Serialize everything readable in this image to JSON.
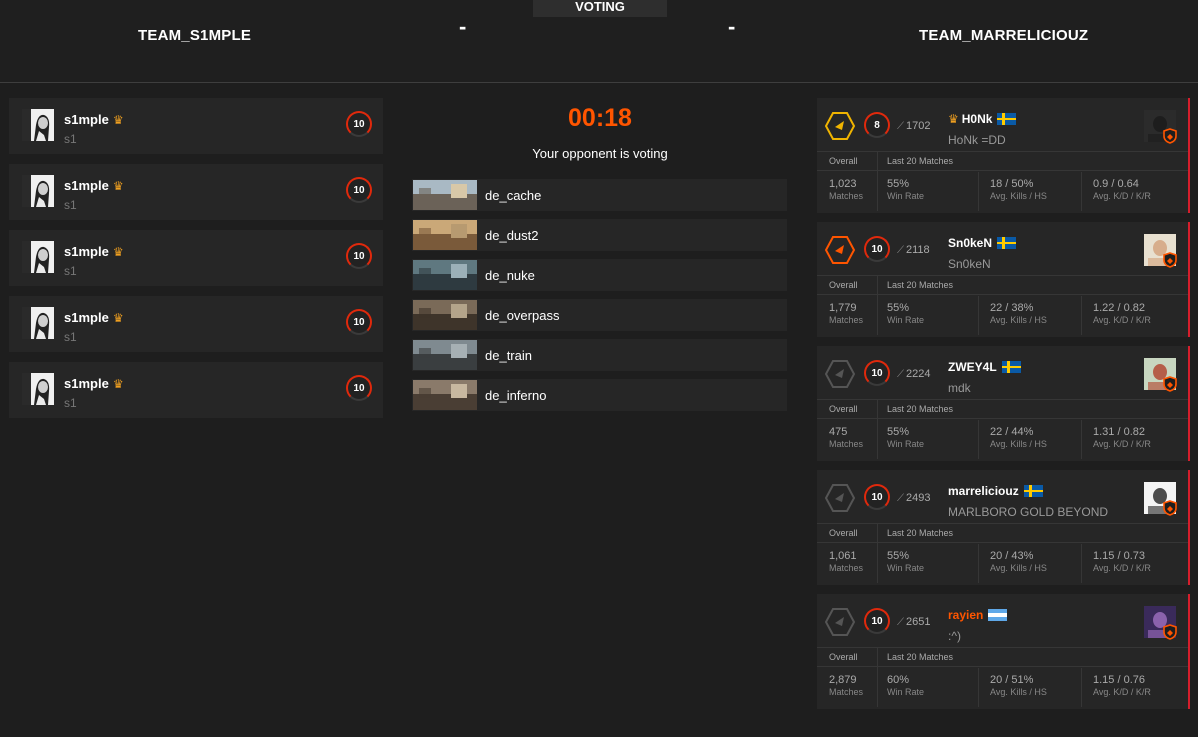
{
  "header": {
    "voting_label": "VOTING",
    "team_left": "TEAM_S1MPLE",
    "team_right": "TEAM_MARRELICIOUZ",
    "score_left": "-",
    "score_right": "-"
  },
  "left_team": {
    "players": [
      {
        "name": "s1mple",
        "nick": "s1",
        "level": "10"
      },
      {
        "name": "s1mple",
        "nick": "s1",
        "level": "10"
      },
      {
        "name": "s1mple",
        "nick": "s1",
        "level": "10"
      },
      {
        "name": "s1mple",
        "nick": "s1",
        "level": "10"
      },
      {
        "name": "s1mple",
        "nick": "s1",
        "level": "10"
      }
    ]
  },
  "center": {
    "timer": "00:18",
    "status": "Your opponent is voting",
    "maps": [
      {
        "name": "de_cache"
      },
      {
        "name": "de_dust2"
      },
      {
        "name": "de_nuke"
      },
      {
        "name": "de_overpass"
      },
      {
        "name": "de_train"
      },
      {
        "name": "de_inferno"
      }
    ]
  },
  "right_team": {
    "header_overall": "Overall",
    "header_last20": "Last 20 Matches",
    "label_matches": "Matches",
    "label_winrate": "Win Rate",
    "label_kills": "Avg. Kills / HS",
    "label_kd": "Avg. K/D / K/R",
    "players": [
      {
        "name": "H0Nk",
        "tag": "HoNk =DD",
        "level": "8",
        "elo": "1702",
        "flag": "se",
        "leader": true,
        "matches": "1,023",
        "winrate": "55%",
        "kills": "18 / 50%",
        "kd": "0.9 / 0.64",
        "rank_color": "#f0b400"
      },
      {
        "name": "Sn0keN",
        "tag": "Sn0keN",
        "level": "10",
        "elo": "2118",
        "flag": "se",
        "leader": false,
        "matches": "1,779",
        "winrate": "55%",
        "kills": "22 / 38%",
        "kd": "1.22 / 0.82",
        "rank_color": "#ff5500"
      },
      {
        "name": "ZWEY4L",
        "tag": "mdk",
        "level": "10",
        "elo": "2224",
        "flag": "se",
        "leader": false,
        "matches": "475",
        "winrate": "55%",
        "kills": "22 / 44%",
        "kd": "1.31 / 0.82",
        "rank_color": "#555555"
      },
      {
        "name": "marreliciouz",
        "tag": "MARLBORO GOLD BEYOND",
        "level": "10",
        "elo": "2493",
        "flag": "se",
        "leader": false,
        "matches": "1,061",
        "winrate": "55%",
        "kills": "20 / 43%",
        "kd": "1.15 / 0.73",
        "rank_color": "#555555"
      },
      {
        "name": "rayien",
        "tag": ":^)",
        "level": "10",
        "elo": "2651",
        "flag": "ar",
        "leader": false,
        "matches": "2,879",
        "winrate": "60%",
        "kills": "20 / 51%",
        "kd": "1.15 / 0.76",
        "rank_color": "#555555"
      }
    ]
  },
  "colors": {
    "accent": "#ff5500",
    "level_red": "#e0290c",
    "crown": "#f0a020",
    "side_bar": "#d61e2c"
  }
}
